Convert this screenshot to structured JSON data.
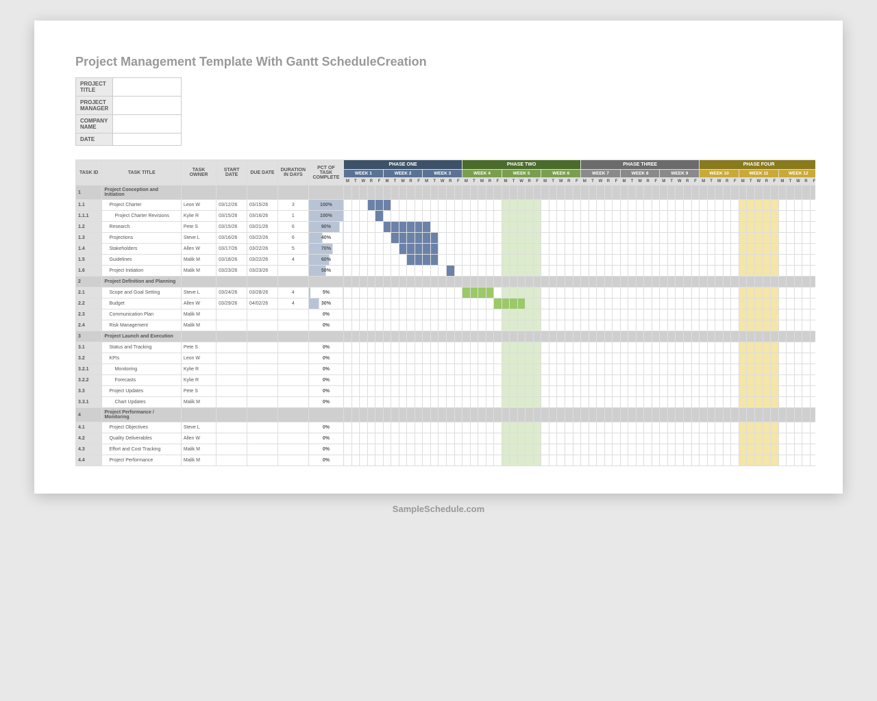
{
  "title": "Project Management Template With Gantt ScheduleCreation",
  "meta_labels": [
    "PROJECT TITLE",
    "PROJECT MANAGER",
    "COMPANY NAME",
    "DATE"
  ],
  "cols": {
    "id": "TASK ID",
    "title": "TASK TITLE",
    "owner": "TASK OWNER",
    "start": "START DATE",
    "due": "DUE DATE",
    "dur": "DURATION IN DAYS",
    "pct": "PCT OF TASK COMPLETE"
  },
  "phases": [
    {
      "label": "PHASE ONE",
      "cls": "phase1",
      "weeks": [
        {
          "label": "WEEK 1",
          "cls": "wk1"
        },
        {
          "label": "WEEK 2",
          "cls": "wk1"
        },
        {
          "label": "WEEK 3",
          "cls": "wk1"
        }
      ]
    },
    {
      "label": "PHASE TWO",
      "cls": "phase2",
      "weeks": [
        {
          "label": "WEEK 4",
          "cls": "wk2"
        },
        {
          "label": "WEEK 5",
          "cls": "wk2"
        },
        {
          "label": "WEEK 6",
          "cls": "wk2"
        }
      ]
    },
    {
      "label": "PHASE THREE",
      "cls": "phase3",
      "weeks": [
        {
          "label": "WEEK 7",
          "cls": "wk3"
        },
        {
          "label": "WEEK 8",
          "cls": "wk3"
        },
        {
          "label": "WEEK 9",
          "cls": "wk3"
        }
      ]
    },
    {
      "label": "PHASE FOUR",
      "cls": "phase4",
      "weeks": [
        {
          "label": "WEEK 10",
          "cls": "wk4"
        },
        {
          "label": "WEEK 11",
          "cls": "wk4"
        },
        {
          "label": "WEEK 12",
          "cls": "wk4"
        }
      ]
    }
  ],
  "days": [
    "M",
    "T",
    "W",
    "R",
    "F"
  ],
  "shade_cols": {
    "green": [
      20,
      21,
      22,
      23,
      24
    ],
    "yellow": [
      50,
      51,
      52,
      53,
      54
    ]
  },
  "rows": [
    {
      "id": "1",
      "title": "Project Conception and Initiation",
      "section": true
    },
    {
      "id": "1.1",
      "title": "Project Charter",
      "owner": "Leon W",
      "start": "03/12/26",
      "due": "03/15/26",
      "dur": "3",
      "pct": "100%",
      "indent": 1,
      "bar": {
        "from": 3,
        "to": 6,
        "cls": "bar-blue"
      }
    },
    {
      "id": "1.1.1",
      "title": "Project Charter Revisions",
      "owner": "Kylie R",
      "start": "03/15/26",
      "due": "03/16/26",
      "dur": "1",
      "pct": "100%",
      "indent": 2,
      "bar": {
        "from": 4,
        "to": 5,
        "cls": "bar-blue"
      }
    },
    {
      "id": "1.2",
      "title": "Research",
      "owner": "Pete S",
      "start": "03/15/26",
      "due": "03/21/26",
      "dur": "6",
      "pct": "90%",
      "indent": 1,
      "bar": {
        "from": 5,
        "to": 11,
        "cls": "bar-blue"
      }
    },
    {
      "id": "1.3",
      "title": "Projections",
      "owner": "Steve L",
      "start": "03/16/26",
      "due": "03/22/26",
      "dur": "6",
      "pct": "40%",
      "indent": 1,
      "bar": {
        "from": 6,
        "to": 12,
        "cls": "bar-blue"
      }
    },
    {
      "id": "1.4",
      "title": "Stakeholders",
      "owner": "Allen W",
      "start": "03/17/26",
      "due": "03/22/26",
      "dur": "5",
      "pct": "70%",
      "indent": 1,
      "bar": {
        "from": 7,
        "to": 12,
        "cls": "bar-blue"
      }
    },
    {
      "id": "1.5",
      "title": "Guidelines",
      "owner": "Malik M",
      "start": "03/18/26",
      "due": "03/22/26",
      "dur": "4",
      "pct": "60%",
      "indent": 1,
      "bar": {
        "from": 8,
        "to": 12,
        "cls": "bar-blue"
      }
    },
    {
      "id": "1.6",
      "title": "Project Initiation",
      "owner": "Malik M",
      "start": "03/23/26",
      "due": "03/23/26",
      "dur": "",
      "pct": "50%",
      "indent": 1,
      "bar": {
        "from": 13,
        "to": 14,
        "cls": "bar-blue"
      }
    },
    {
      "id": "2",
      "title": "Project Definition and Planning",
      "section": true
    },
    {
      "id": "2.1",
      "title": "Scope and Goal Setting",
      "owner": "Steve L",
      "start": "03/24/26",
      "due": "03/28/26",
      "dur": "4",
      "pct": "5%",
      "indent": 1,
      "bar": {
        "from": 15,
        "to": 19,
        "cls": "bar-green"
      }
    },
    {
      "id": "2.2",
      "title": "Budget",
      "owner": "Allen W",
      "start": "03/29/26",
      "due": "04/02/26",
      "dur": "4",
      "pct": "30%",
      "indent": 1,
      "bar": {
        "from": 19,
        "to": 23,
        "cls": "bar-green"
      }
    },
    {
      "id": "2.3",
      "title": "Communication Plan",
      "owner": "Malik M",
      "start": "",
      "due": "",
      "dur": "",
      "pct": "0%",
      "indent": 1
    },
    {
      "id": "2.4",
      "title": "Risk Management",
      "owner": "Malik M",
      "start": "",
      "due": "",
      "dur": "",
      "pct": "0%",
      "indent": 1
    },
    {
      "id": "3",
      "title": "Project Launch and Execution",
      "section": true
    },
    {
      "id": "3.1",
      "title": "Status and Tracking",
      "owner": "Pete S",
      "start": "",
      "due": "",
      "dur": "",
      "pct": "0%",
      "indent": 1
    },
    {
      "id": "3.2",
      "title": "KPIs",
      "owner": "Leon W",
      "start": "",
      "due": "",
      "dur": "",
      "pct": "0%",
      "indent": 1
    },
    {
      "id": "3.2.1",
      "title": "Monitoring",
      "owner": "Kylie R",
      "start": "",
      "due": "",
      "dur": "",
      "pct": "0%",
      "indent": 2
    },
    {
      "id": "3.2.2",
      "title": "Forecasts",
      "owner": "Kylie R",
      "start": "",
      "due": "",
      "dur": "",
      "pct": "0%",
      "indent": 2
    },
    {
      "id": "3.3",
      "title": "Project Updates",
      "owner": "Pete S",
      "start": "",
      "due": "",
      "dur": "",
      "pct": "0%",
      "indent": 1
    },
    {
      "id": "3.3.1",
      "title": "Chart Updates",
      "owner": "Malik M",
      "start": "",
      "due": "",
      "dur": "",
      "pct": "0%",
      "indent": 2
    },
    {
      "id": "4",
      "title": "Project Performance / Monitoring",
      "section": true
    },
    {
      "id": "4.1",
      "title": "Project Objectives",
      "owner": "Steve L",
      "start": "",
      "due": "",
      "dur": "",
      "pct": "0%",
      "indent": 1
    },
    {
      "id": "4.2",
      "title": "Quality Deliverables",
      "owner": "Allen W",
      "start": "",
      "due": "",
      "dur": "",
      "pct": "0%",
      "indent": 1
    },
    {
      "id": "4.3",
      "title": "Effort and Cost Tracking",
      "owner": "Malik M",
      "start": "",
      "due": "",
      "dur": "",
      "pct": "0%",
      "indent": 1
    },
    {
      "id": "4.4",
      "title": "Project Performance",
      "owner": "Malik M",
      "start": "",
      "due": "",
      "dur": "",
      "pct": "0%",
      "indent": 1
    }
  ],
  "footer": "SampleSchedule.com"
}
